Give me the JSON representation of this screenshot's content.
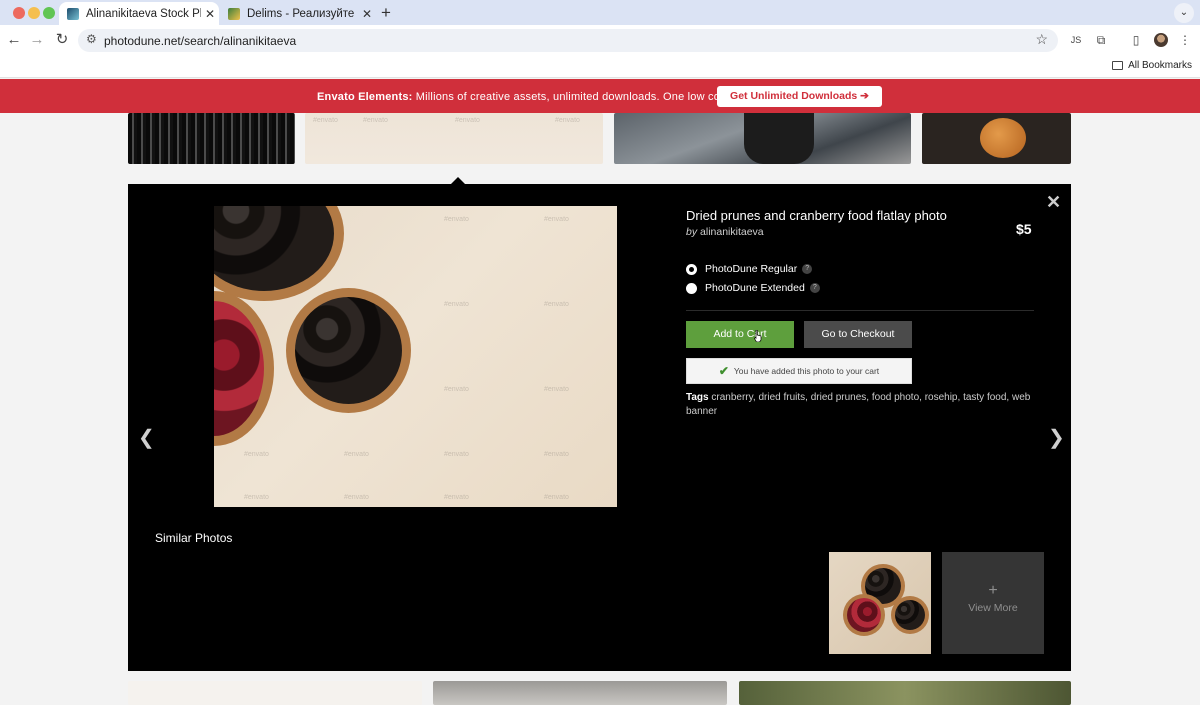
{
  "browser": {
    "tabs": [
      {
        "title": "Alinanikitaeva Stock Photos &",
        "active": true
      },
      {
        "title": "Delims - Реализуйте свою ф",
        "active": false
      }
    ],
    "new_tab": "+",
    "url": "photodune.net/search/alinanikitaeva",
    "bookmarks_label": "All Bookmarks"
  },
  "banner": {
    "brand": "Envato Elements:",
    "text": "Millions of creative assets, unlimited downloads. One low cost.",
    "cta": "Get Unlimited Downloads ➔"
  },
  "detail": {
    "title": "Dried prunes and cranberry food flatlay photo",
    "by_prefix": "by",
    "author": "alinanikitaeva",
    "price": "$5",
    "licenses": [
      {
        "label": "PhotoDune Regular",
        "selected": true,
        "help": "?"
      },
      {
        "label": "PhotoDune Extended",
        "selected": false,
        "help": "?"
      }
    ],
    "add_to_cart": "Add to Cart",
    "checkout": "Go to Checkout",
    "added_message": "You have added this photo to your cart",
    "tags_label": "Tags",
    "tags": [
      "cranberry",
      "dried fruits",
      "dried prunes",
      "food photo",
      "rosehip",
      "tasty food",
      "web banner"
    ],
    "watermark": "#envato"
  },
  "similar": {
    "heading": "Similar Photos",
    "view_more": "View More",
    "plus": "+"
  },
  "colors": {
    "banner": "#d02f3b",
    "cart_button": "#5e9f3d",
    "checkout_button": "#4b4b4b"
  }
}
